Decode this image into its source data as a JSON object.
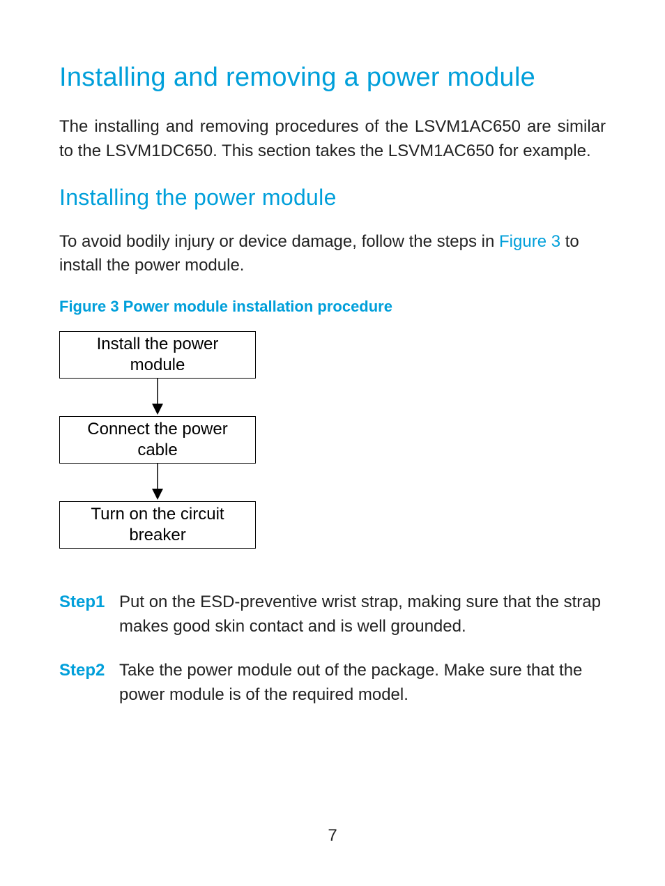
{
  "heading1": "Installing and removing a power module",
  "intro": "The installing and removing procedures of the LSVM1AC650 are similar to the LSVM1DC650. This section takes the LSVM1AC650 for example.",
  "heading2": "Installing the power module",
  "para2_pre": "To avoid bodily injury or device damage, follow the steps in ",
  "para2_link": "Figure 3",
  "para2_post": " to install the power module.",
  "figure_caption": "Figure 3 Power module installation procedure",
  "flow": {
    "box1_line1": "Install the power",
    "box1_line2": "module",
    "box2_line1": "Connect the power",
    "box2_line2": "cable",
    "box3_line1": "Turn on the circuit",
    "box3_line2": "breaker"
  },
  "steps": [
    {
      "label": "Step1",
      "text": "Put on the ESD-preventive wrist strap, making sure that the strap makes good skin contact and is well grounded."
    },
    {
      "label": "Step2",
      "text": "Take the power module out of the package. Make sure that the power module is of the required model."
    }
  ],
  "page_number": "7"
}
